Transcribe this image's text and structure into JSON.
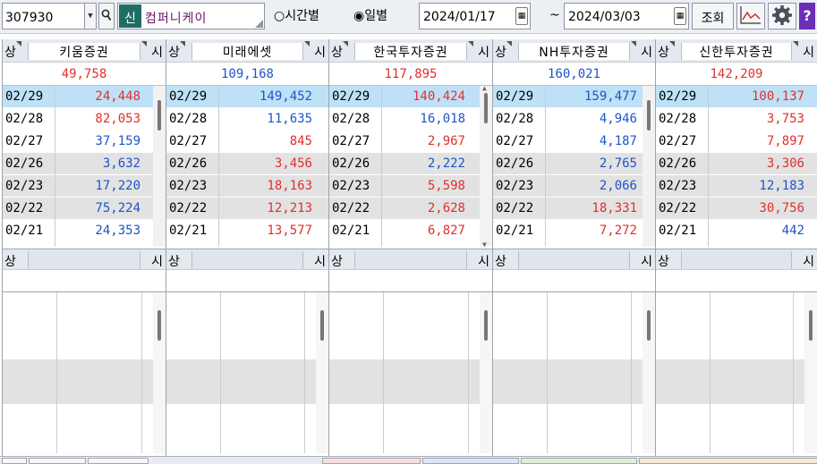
{
  "toolbar": {
    "stock_code": "307930",
    "name_badge": "신",
    "stock_name": "컴퍼니케이",
    "radio_time": "○시간별",
    "radio_day": "◉일별",
    "date_from": "2024/01/17",
    "tilde": "~",
    "date_to": "2024/03/03",
    "query_button": "조회",
    "question_button": "?",
    "icons": [
      "chevron-down-icon",
      "search-icon",
      "calendar-icon",
      "chart-icon",
      "gear-icon",
      "help-icon"
    ]
  },
  "header_labels": {
    "sell": "상",
    "buy": "시"
  },
  "colors": {
    "red": "#e0302c",
    "blue": "#1d55c8",
    "highlight": "#bfe1f7",
    "gray_band": "#e2e2e2",
    "accent": "#1f6e66"
  },
  "brokers": [
    {
      "name": "키움증권",
      "total": "49,758",
      "total_color": "red",
      "rows": [
        [
          "02/29",
          "24,448",
          "red"
        ],
        [
          "02/28",
          "82,053",
          "red"
        ],
        [
          "02/27",
          "37,159",
          "blue"
        ],
        [
          "02/26",
          "3,632",
          "blue"
        ],
        [
          "02/23",
          "17,220",
          "blue"
        ],
        [
          "02/22",
          "75,224",
          "blue"
        ],
        [
          "02/21",
          "24,353",
          "blue"
        ]
      ]
    },
    {
      "name": "미래에셋",
      "total": "109,168",
      "total_color": "blue",
      "rows": [
        [
          "02/29",
          "149,452",
          "blue"
        ],
        [
          "02/28",
          "11,635",
          "blue"
        ],
        [
          "02/27",
          "845",
          "red"
        ],
        [
          "02/26",
          "3,456",
          "red"
        ],
        [
          "02/23",
          "18,163",
          "red"
        ],
        [
          "02/22",
          "12,213",
          "red"
        ],
        [
          "02/21",
          "13,577",
          "red"
        ]
      ]
    },
    {
      "name": "한국투자증권",
      "total": "117,895",
      "total_color": "red",
      "rows": [
        [
          "02/29",
          "140,424",
          "red"
        ],
        [
          "02/28",
          "16,018",
          "blue"
        ],
        [
          "02/27",
          "2,967",
          "red"
        ],
        [
          "02/26",
          "2,222",
          "blue"
        ],
        [
          "02/23",
          "5,598",
          "red"
        ],
        [
          "02/22",
          "2,628",
          "red"
        ],
        [
          "02/21",
          "6,827",
          "red"
        ]
      ]
    },
    {
      "name": "NH투자증권",
      "total": "160,021",
      "total_color": "blue",
      "rows": [
        [
          "02/29",
          "159,477",
          "blue"
        ],
        [
          "02/28",
          "4,946",
          "blue"
        ],
        [
          "02/27",
          "4,187",
          "blue"
        ],
        [
          "02/26",
          "2,765",
          "blue"
        ],
        [
          "02/23",
          "2,066",
          "blue"
        ],
        [
          "02/22",
          "18,331",
          "red"
        ],
        [
          "02/21",
          "7,272",
          "red"
        ]
      ]
    },
    {
      "name": "신한투자증권",
      "total": "142,209",
      "total_color": "red",
      "rows": [
        [
          "02/29",
          "100,137",
          "red"
        ],
        [
          "02/28",
          "3,753",
          "red"
        ],
        [
          "02/27",
          "7,897",
          "red"
        ],
        [
          "02/26",
          "3,306",
          "red"
        ],
        [
          "02/23",
          "12,183",
          "blue"
        ],
        [
          "02/22",
          "30,756",
          "red"
        ],
        [
          "02/21",
          "442",
          "blue"
        ]
      ]
    }
  ]
}
